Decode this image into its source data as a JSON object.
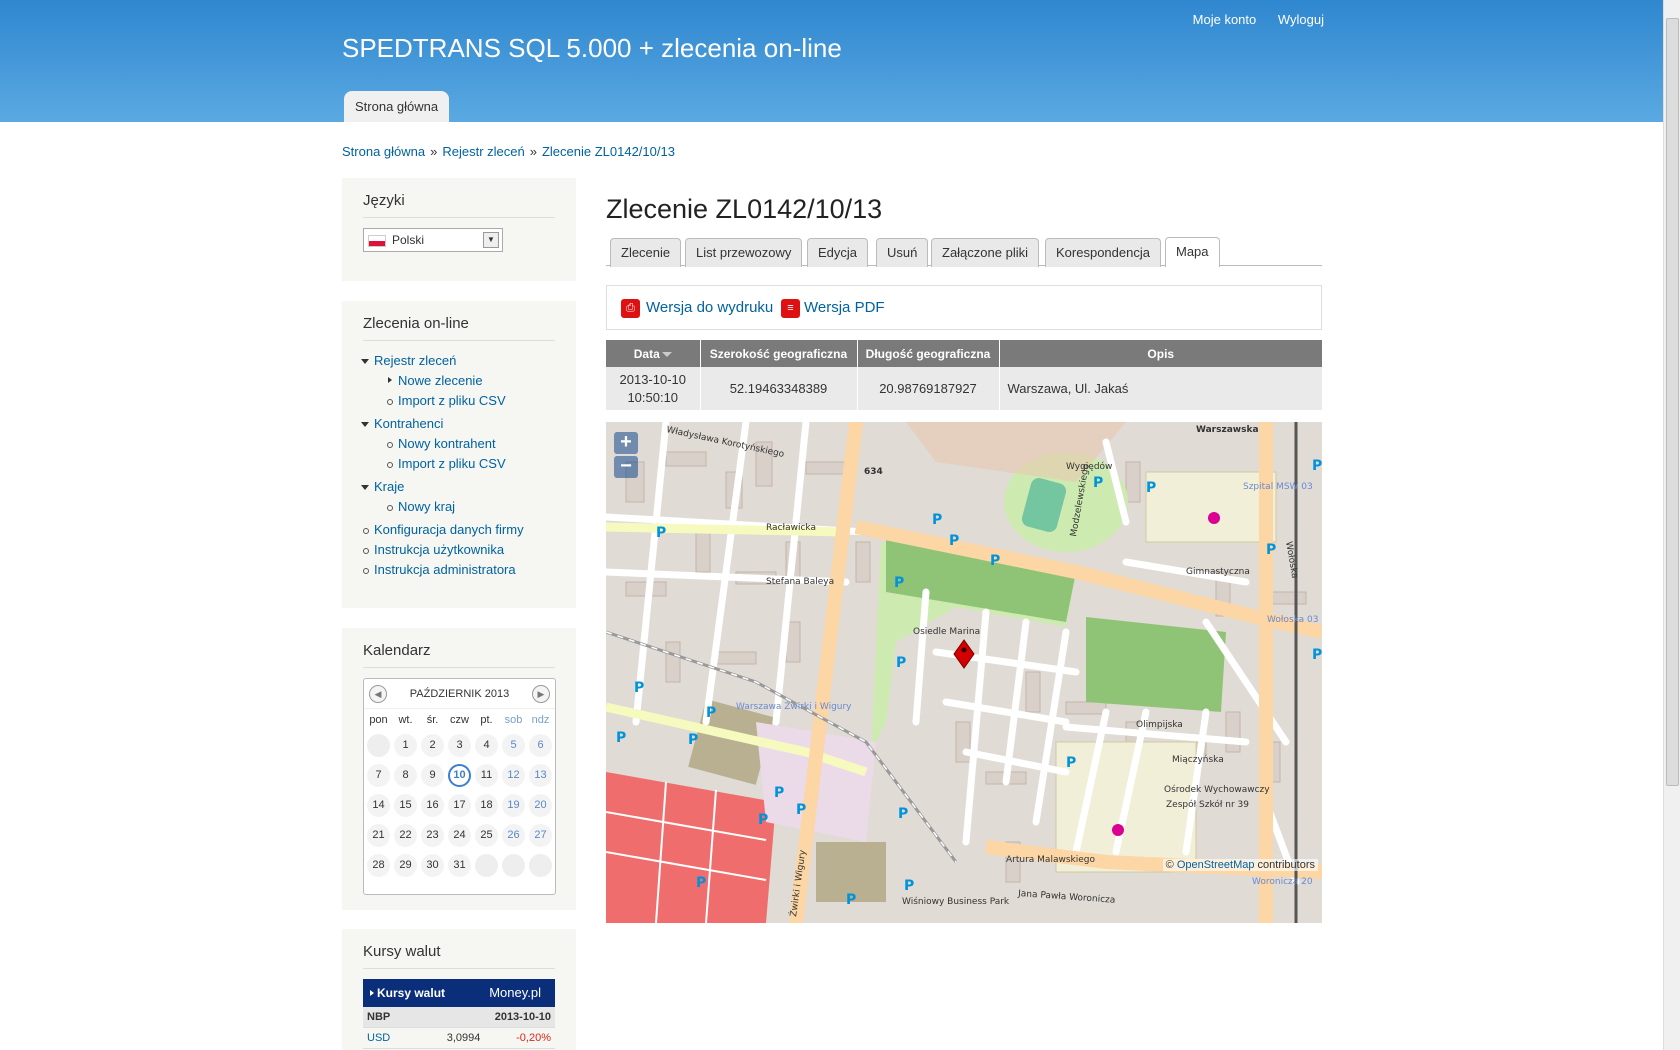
{
  "header": {
    "site_name": "SPEDTRANS SQL 5.000 + zlecenia on-line",
    "account_link": "Moje konto",
    "logout_link": "Wyloguj",
    "main_tab": "Strona główna"
  },
  "breadcrumb": [
    "Strona główna",
    "Rejestr zleceń",
    "Zlecenie ZL0142/10/13"
  ],
  "breadcrumb_sep": "»",
  "languages": {
    "title": "Języki",
    "selected": "Polski"
  },
  "orders_nav": {
    "title": "Zlecenia on-line",
    "items": [
      "Rejestr zleceń",
      "Nowe zlecenie",
      "Import z pliku CSV",
      "Kontrahenci",
      "Nowy kontrahent",
      "Import z pliku CSV",
      "Kraje",
      "Nowy kraj",
      "Konfiguracja danych firmy",
      "Instrukcja użytkownika",
      "Instrukcja administratora"
    ]
  },
  "calendar": {
    "title": "Kalendarz",
    "month": "PAŹDZIERNIK 2013",
    "prev": "◀",
    "next": "▶",
    "day_headers": [
      "pon",
      "wt.",
      "śr.",
      "czw",
      "pt.",
      "sob",
      "ndz"
    ],
    "weeks": [
      [
        "",
        "1",
        "2",
        "3",
        "4",
        "5",
        "6"
      ],
      [
        "7",
        "8",
        "9",
        "10",
        "11",
        "12",
        "13"
      ],
      [
        "14",
        "15",
        "16",
        "17",
        "18",
        "19",
        "20"
      ],
      [
        "21",
        "22",
        "23",
        "24",
        "25",
        "26",
        "27"
      ],
      [
        "28",
        "29",
        "30",
        "31",
        "",
        "",
        ""
      ]
    ],
    "today": "10"
  },
  "fx": {
    "title": "Kursy walut",
    "widget_title": "Kursy walut",
    "brand": "Money.pl",
    "source": "NBP",
    "date": "2013-10-10",
    "rows": [
      {
        "currency": "USD",
        "rate": "3,0994",
        "change": "-0,20%"
      }
    ]
  },
  "main": {
    "title": "Zlecenie ZL0142/10/13",
    "tabs": [
      "Zlecenie",
      "List przewozowy",
      "Edycja",
      "Usuń",
      "Załączone pliki",
      "Korespondencja",
      "Mapa"
    ],
    "active_tab": "Mapa",
    "print_label": "Wersja do wydruku",
    "pdf_label": "Wersja PDF"
  },
  "coord_table": {
    "headers": [
      "Data",
      "Szerokość geograficzna",
      "Długość geograficzna",
      "Opis"
    ],
    "rows": [
      {
        "date": "2013-10-10",
        "time": "10:50:10",
        "lat": "52.19463348389",
        "lon": "20.98769187927",
        "desc": "Warszawa, Ul. Jakaś"
      }
    ]
  },
  "map": {
    "zoom_in": "+",
    "zoom_out": "−",
    "attribution_prefix": "© ",
    "attribution_link": "OpenStreetMap",
    "attribution_suffix": " contributors",
    "labels": [
      "Władysława Korotyńskiego",
      "Racławicka",
      "Stefana Baleya",
      "Warszawska",
      "Wygiędów",
      "Szpital MSW 03",
      "Gimnastyczna",
      "Wołoska 03",
      "Osiedle Marina",
      "Warszawa Żwirki i Wigury",
      "Olimpijska",
      "Ośrodek Wychowawczy",
      "Jana Pawła Woronicza",
      "Woronicza 20",
      "Wiśniowy Business Park",
      "Wołoska",
      "634",
      "Modzelewskiego",
      "Żwirki i Wigury",
      "Artura Malawskiego",
      "Zespół Szkół nr 39",
      "Miączyńska"
    ],
    "parking_symbol": "P",
    "marker_color": "#d40000",
    "colors": {
      "residential": "#d9d0c9",
      "park": "#b5d29f",
      "grass": "#cdebb0",
      "road_main": "#fcd6a4",
      "road_secondary": "#f7fabf",
      "industrial": "#ebdbe8",
      "rail": "#999999"
    }
  }
}
